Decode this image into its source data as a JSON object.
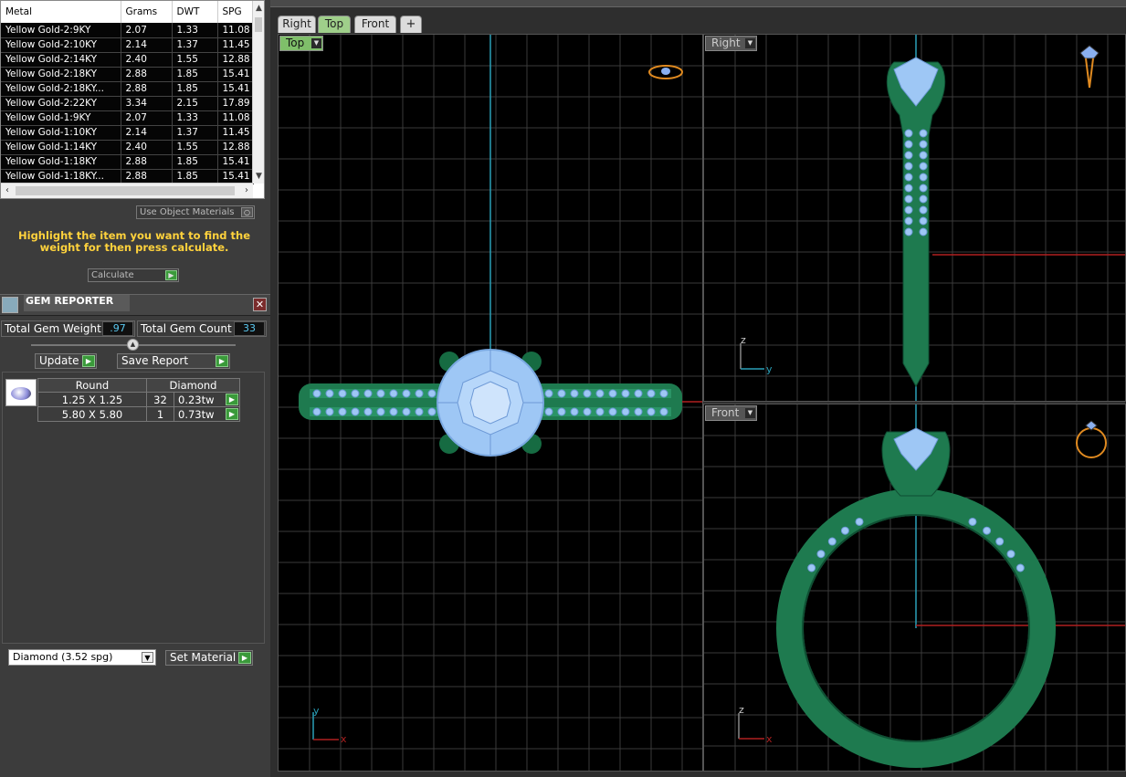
{
  "metal_table": {
    "headers": [
      "Metal",
      "Grams",
      "DWT",
      "SPG"
    ],
    "rows": [
      [
        "Yellow Gold-2:9KY",
        "2.07",
        "1.33",
        "11.08"
      ],
      [
        "Yellow Gold-2:10KY",
        "2.14",
        "1.37",
        "11.45"
      ],
      [
        "Yellow Gold-2:14KY",
        "2.40",
        "1.55",
        "12.88"
      ],
      [
        "Yellow Gold-2:18KY",
        "2.88",
        "1.85",
        "15.41"
      ],
      [
        "Yellow Gold-2:18KY...",
        "2.88",
        "1.85",
        "15.41"
      ],
      [
        "Yellow Gold-2:22KY",
        "3.34",
        "2.15",
        "17.89"
      ],
      [
        "Yellow Gold-1:9KY",
        "2.07",
        "1.33",
        "11.08"
      ],
      [
        "Yellow Gold-1:10KY",
        "2.14",
        "1.37",
        "11.45"
      ],
      [
        "Yellow Gold-1:14KY",
        "2.40",
        "1.55",
        "12.88"
      ],
      [
        "Yellow Gold-1:18KY",
        "2.88",
        "1.85",
        "15.41"
      ],
      [
        "Yellow Gold-1:18KY...",
        "2.88",
        "1.85",
        "15.41"
      ]
    ]
  },
  "use_object_materials": "Use Object Materials",
  "hint": "Highlight the item you want to find the weight for then press calculate.",
  "calculate_label": "Calculate",
  "gem_reporter": {
    "title": "GEM REPORTER",
    "total_weight_label": "Total Gem Weight",
    "total_weight": ".97",
    "total_count_label": "Total Gem Count",
    "total_count": "33",
    "update_label": "Update",
    "save_report_label": "Save Report",
    "table_headers": [
      "Round",
      "Diamond"
    ],
    "rows": [
      {
        "size": "1.25 X 1.25",
        "count": "32",
        "weight": "0.23tw"
      },
      {
        "size": "5.80 X 5.80",
        "count": "1",
        "weight": "0.73tw"
      }
    ]
  },
  "material_select": "Diamond    (3.52 spg)",
  "set_material_label": "Set Material",
  "tabs": [
    "Right",
    "Top",
    "Front"
  ],
  "active_tab": "Top",
  "viewports": {
    "top": {
      "label": "Top",
      "axis_a": "y",
      "axis_b": "x"
    },
    "right": {
      "label": "Right",
      "axis_a": "z",
      "axis_b": "y"
    },
    "front": {
      "label": "Front",
      "axis_a": "z",
      "axis_b": "x"
    }
  },
  "colors": {
    "metal": "#1e7a4f",
    "gem": "#9ec7f5",
    "grid": "#3a3a3a",
    "axis_blue": "#2aa0b8",
    "axis_red": "#b02020",
    "accent_green": "#3a9a3a"
  }
}
